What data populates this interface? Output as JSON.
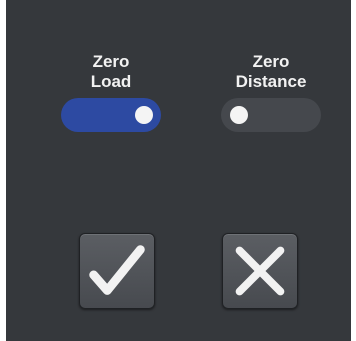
{
  "toggles": [
    {
      "label": "Zero\nLoad",
      "state": "on",
      "color": "#2d4aa2"
    },
    {
      "label": "Zero\nDistance",
      "state": "off",
      "color": "#45484d"
    }
  ],
  "buttons": {
    "confirm_icon": "checkmark-icon",
    "cancel_icon": "close-icon"
  },
  "colors": {
    "panel": "#35383c",
    "text": "#f2f2f2"
  }
}
